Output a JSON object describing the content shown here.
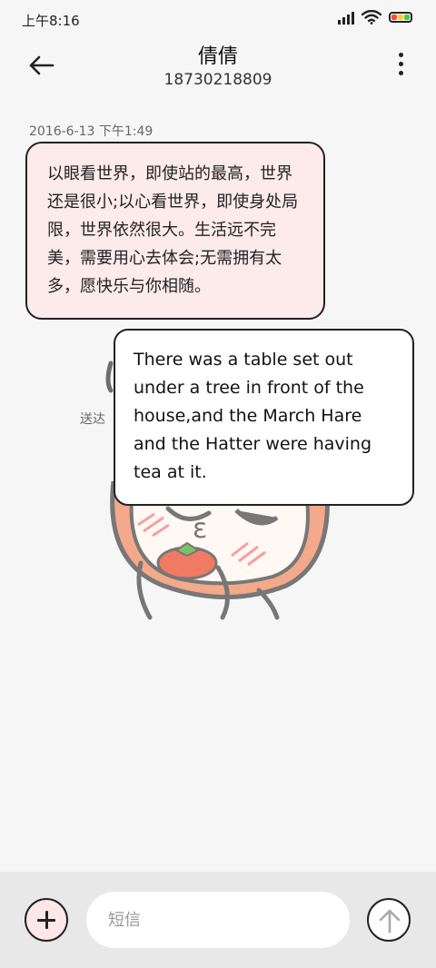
{
  "status_bar": {
    "time": "上午8:16",
    "icons": [
      "signal-icon",
      "wifi-icon",
      "battery-icon"
    ]
  },
  "header": {
    "contact_name": "倩倩",
    "phone_number": "18730218809",
    "icons": [
      "back-arrow-icon",
      "more-vertical-icon"
    ]
  },
  "conversation": {
    "timestamp": "2016-6-13 下午1:49",
    "incoming_message": "以眼看世界，即使站的最高，世界还是很小;以心看世界，即使身处局限，世界依然很大。生活远不完美，需要用心去体会;无需拥有太多，愿快乐与你相随。",
    "outgoing_message": "There was a table set out under a tree in front of the house,and the March Hare and the Hatter were having tea at it.",
    "delivered_label": "送达"
  },
  "composer": {
    "placeholder": "短信",
    "value": "",
    "icons": [
      "add-icon",
      "send-arrow-icon"
    ]
  },
  "colors": {
    "incoming_bubble": "#fdeaea",
    "outgoing_bubble": "#ffffff",
    "input_bar": "#e8e8e8",
    "sticker_face": "#f3a98a"
  }
}
